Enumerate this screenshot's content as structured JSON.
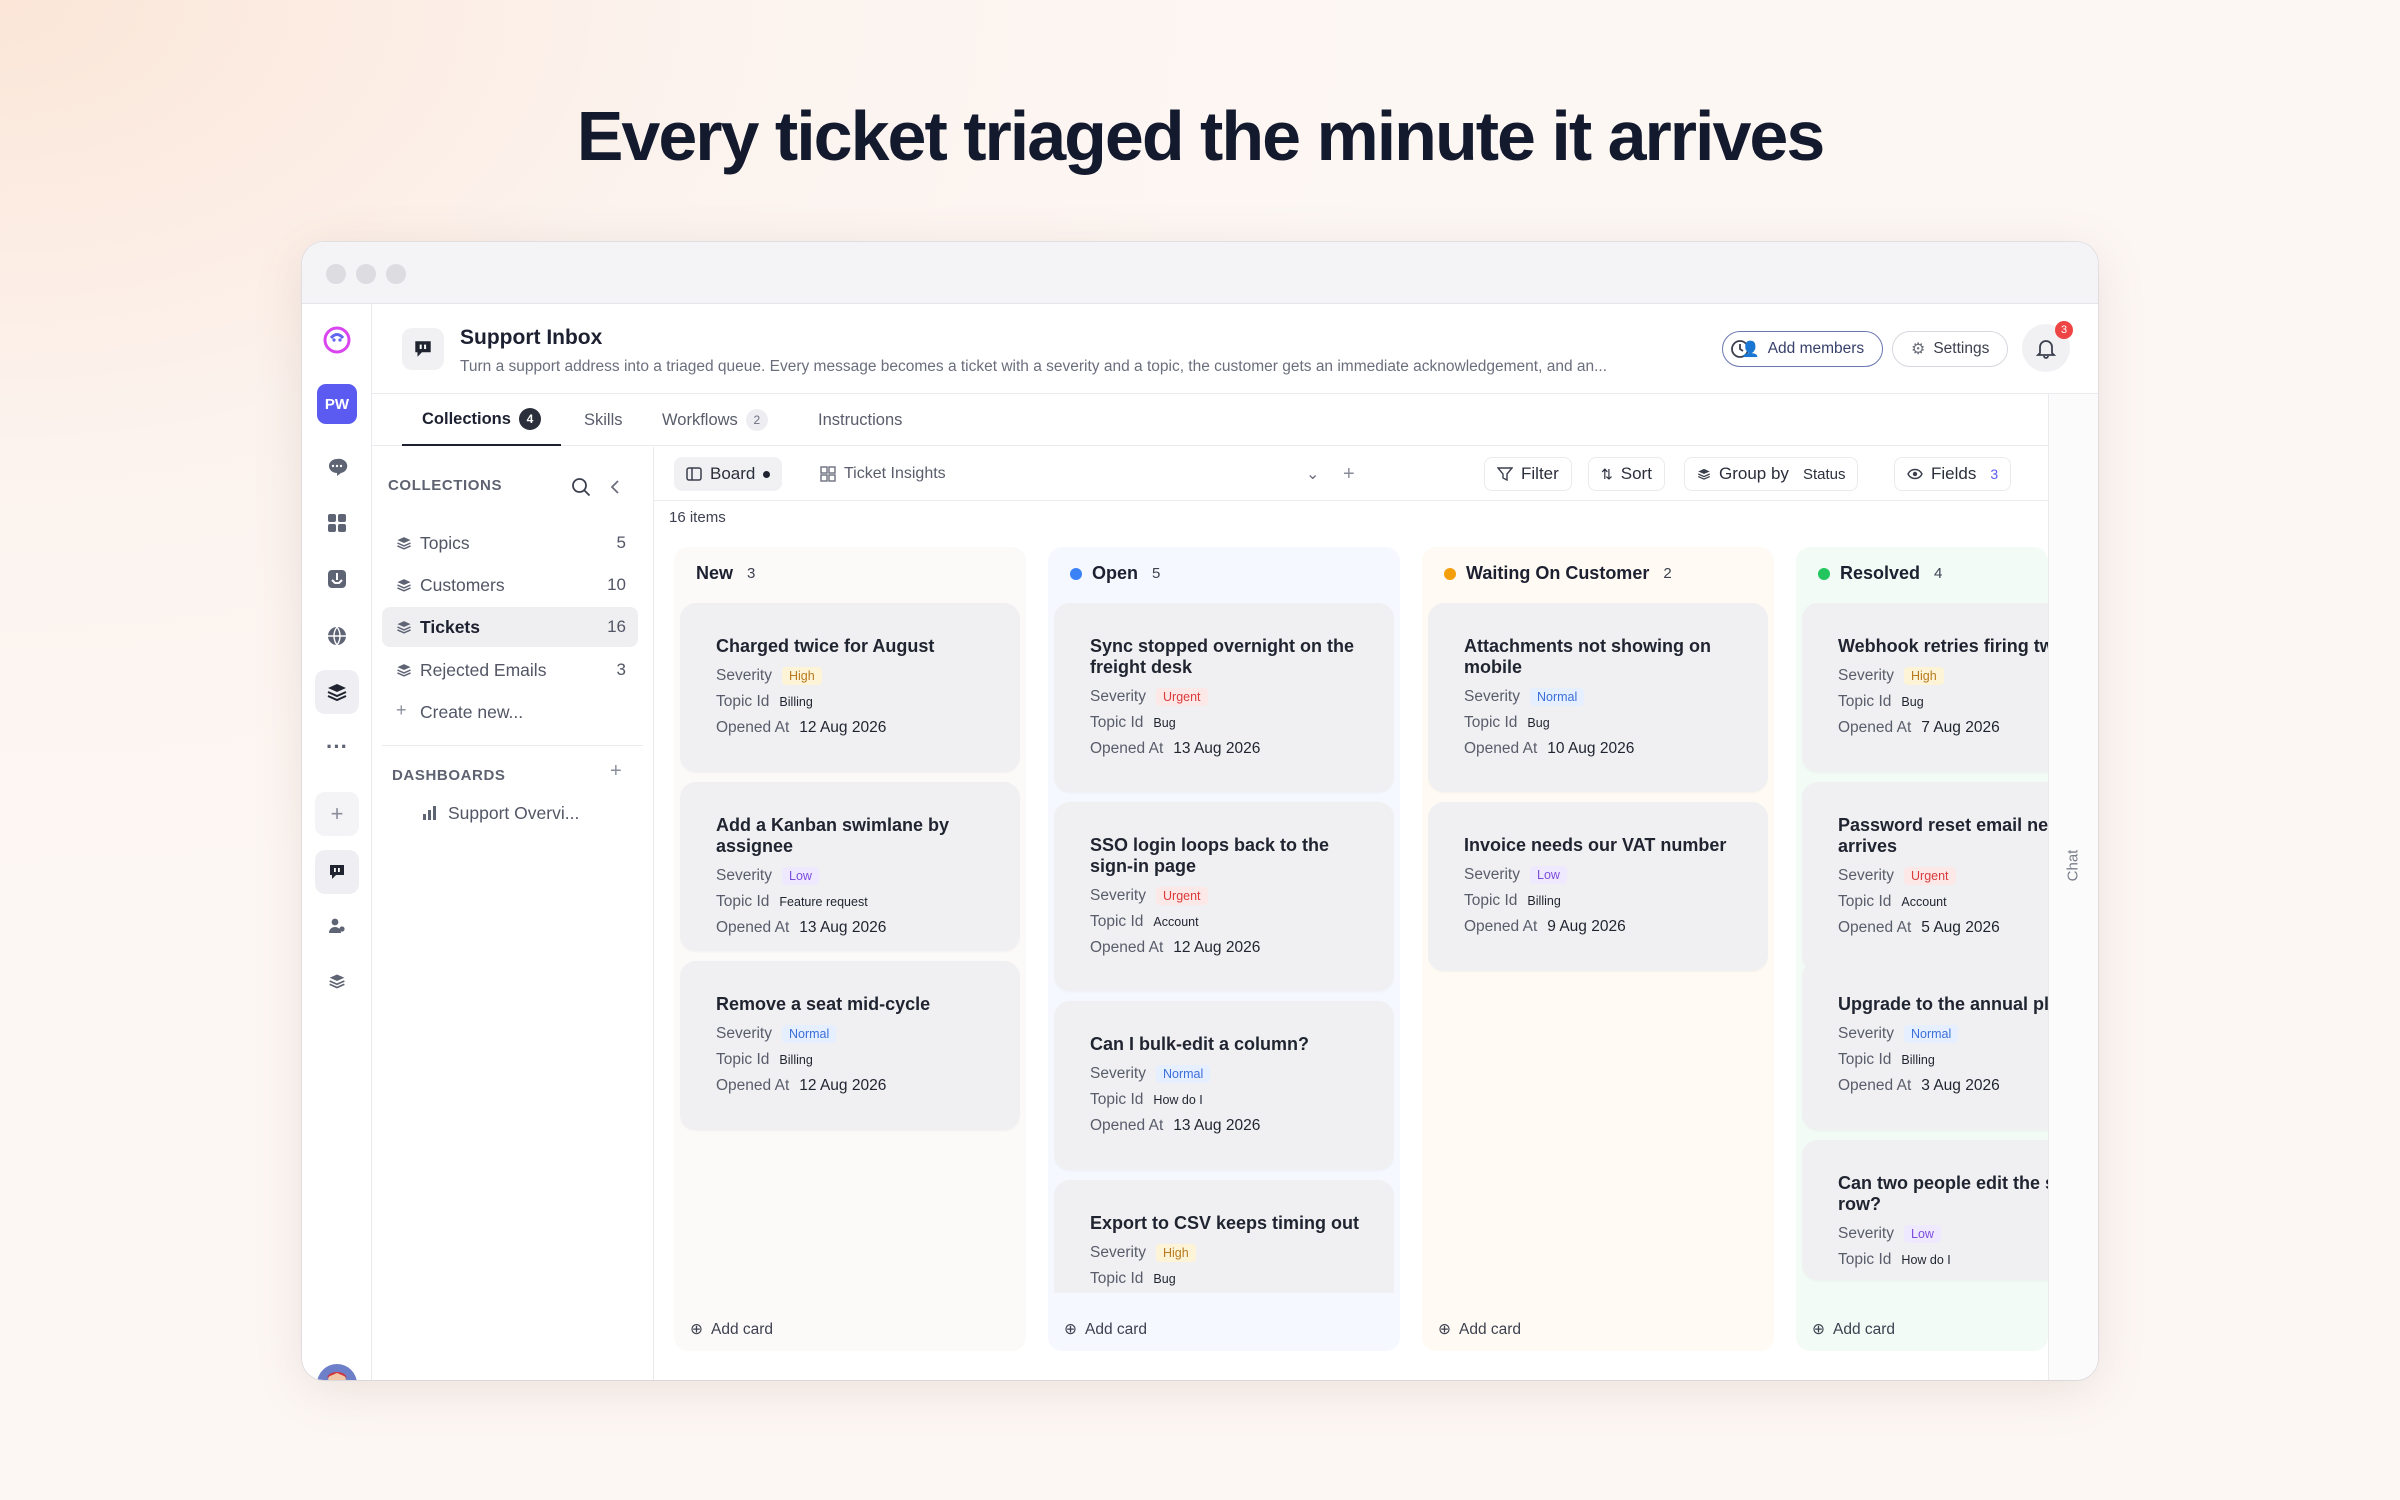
{
  "headline": "Every ticket triaged the minute it arrives",
  "header": {
    "title": "Support Inbox",
    "description": "Turn a support address into a triaged queue. Every message becomes a ticket with a severity and a topic, the customer gets an immediate acknowledgement, and an...",
    "add_members": "Add members",
    "settings": "Settings",
    "notification_count": "3"
  },
  "rail": {
    "workspace_initials": "PW"
  },
  "tabs": [
    {
      "label": "Collections",
      "count": "4"
    },
    {
      "label": "Skills"
    },
    {
      "label": "Workflows",
      "count": "2"
    },
    {
      "label": "Instructions"
    }
  ],
  "chat_label": "Chat",
  "sidebar": {
    "collections_heading": "COLLECTIONS",
    "items": [
      {
        "label": "Topics",
        "count": "5"
      },
      {
        "label": "Customers",
        "count": "10"
      },
      {
        "label": "Tickets",
        "count": "16"
      },
      {
        "label": "Rejected Emails",
        "count": "3"
      }
    ],
    "create_new": "Create new...",
    "dashboards_heading": "DASHBOARDS",
    "dashboard_item": "Support Overvi..."
  },
  "toolbar": {
    "board": "Board",
    "insights": "Ticket Insights",
    "filter": "Filter",
    "sort": "Sort",
    "group_by": "Group by",
    "group_value": "Status",
    "fields": "Fields",
    "fields_count": "3"
  },
  "item_count": "16 items",
  "field_labels": {
    "severity": "Severity",
    "topic": "Topic Id",
    "opened": "Opened At"
  },
  "add_card": "Add card",
  "colors": {
    "accent": "#5b5bf2",
    "open": "#3b82f6",
    "waiting": "#f59e0b",
    "resolved": "#22c55e"
  },
  "columns": [
    {
      "name": "New",
      "count": "3",
      "cards": [
        {
          "title": "Charged twice for August",
          "severity": "High",
          "topic": "Billing",
          "opened": "12 Aug 2026"
        },
        {
          "title": "Add a Kanban swimlane by assignee",
          "severity": "Low",
          "topic": "Feature request",
          "opened": "13 Aug 2026"
        },
        {
          "title": "Remove a seat mid-cycle",
          "severity": "Normal",
          "topic": "Billing",
          "opened": "12 Aug 2026"
        }
      ]
    },
    {
      "name": "Open",
      "count": "5",
      "cards": [
        {
          "title": "Sync stopped overnight on the freight desk",
          "severity": "Urgent",
          "topic": "Bug",
          "opened": "13 Aug 2026"
        },
        {
          "title": "SSO login loops back to the sign-in page",
          "severity": "Urgent",
          "topic": "Account",
          "opened": "12 Aug 2026"
        },
        {
          "title": "Can I bulk-edit a column?",
          "severity": "Normal",
          "topic": "How do I",
          "opened": "13 Aug 2026"
        },
        {
          "title": "Export to CSV keeps timing out",
          "severity": "High",
          "topic": "Bug",
          "opened": ""
        }
      ]
    },
    {
      "name": "Waiting On Customer",
      "count": "2",
      "cards": [
        {
          "title": "Attachments not showing on mobile",
          "severity": "Normal",
          "topic": "Bug",
          "opened": "10 Aug 2026"
        },
        {
          "title": "Invoice needs our VAT number",
          "severity": "Low",
          "topic": "Billing",
          "opened": "9 Aug 2026"
        }
      ]
    },
    {
      "name": "Resolved",
      "count": "4",
      "cards": [
        {
          "title": "Webhook retries firing twice",
          "severity": "High",
          "topic": "Bug",
          "opened": "7 Aug 2026"
        },
        {
          "title": "Password reset email never arrives",
          "severity": "Urgent",
          "topic": "Account",
          "opened": "5 Aug 2026"
        },
        {
          "title": "Upgrade to the annual plan",
          "severity": "Normal",
          "topic": "Billing",
          "opened": "3 Aug 2026"
        },
        {
          "title": "Can two people edit the same row?",
          "severity": "Low",
          "topic": "How do I",
          "opened": ""
        }
      ]
    }
  ]
}
